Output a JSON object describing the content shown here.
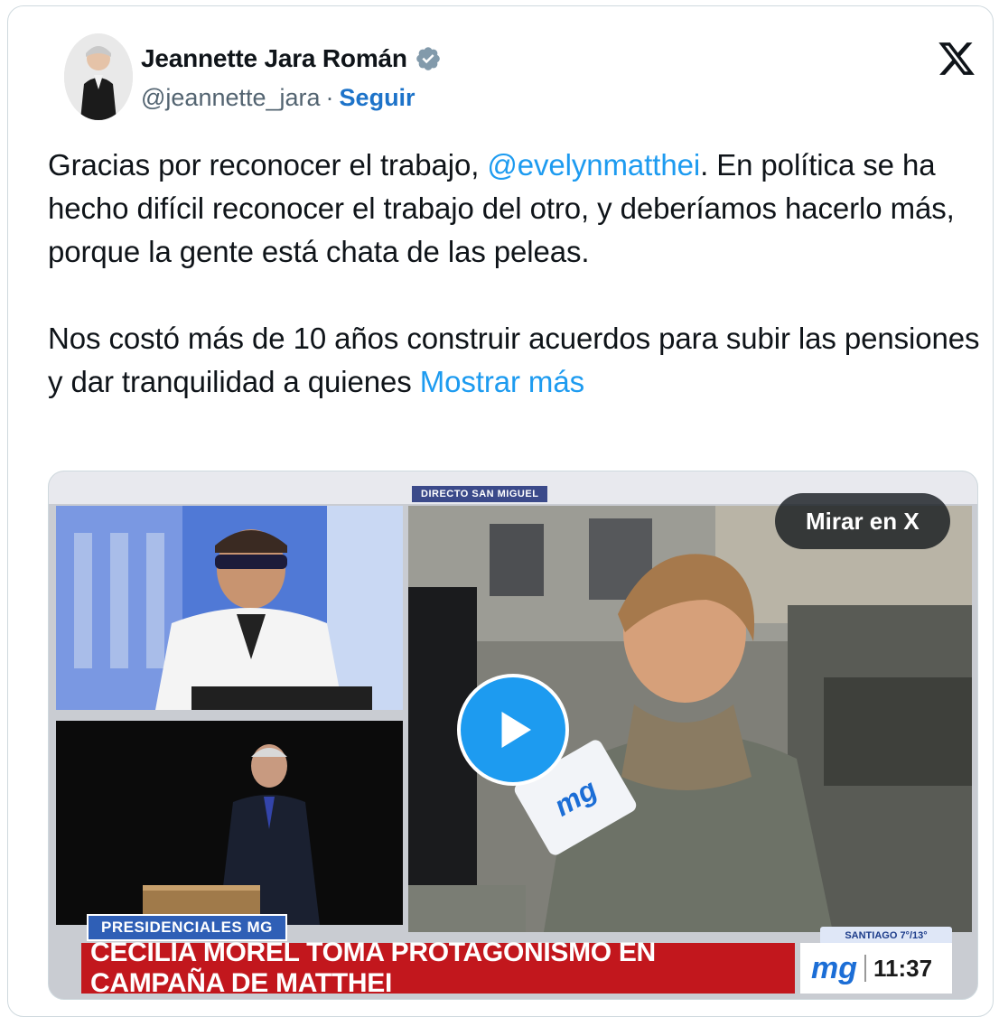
{
  "author": {
    "name": "Jeannette Jara Román",
    "handle": "@jeannette_jara",
    "separator": "·",
    "follow_label": "Seguir"
  },
  "tweet": {
    "p1_a": "Gracias por reconocer el trabajo, ",
    "mention": "@evelynmatthei",
    "p1_b": ". En política se ha hecho difícil reconocer el trabajo del otro, y deberíamos hacerlo más, porque la gente está chata de las peleas.",
    "p2": "Nos costó más de 10 años construir acuerdos para subir las pensiones y dar tranquilidad a quienes ",
    "show_more": "Mostrar más"
  },
  "media": {
    "watch_label": "Mirar en X",
    "direct_tag": "DIRECTO SAN MIGUEL",
    "section_tag": "PRESIDENCIALES MG",
    "headline": "CECILIA MOREL TOMA PROTAGONISMO EN CAMPAÑA DE MATTHEI",
    "brand_logo": "mg",
    "time": "11:37",
    "weather": "SANTIAGO 7°/13°",
    "mic_logo": "mg"
  },
  "colors": {
    "link": "#1d9bf0",
    "follow": "#1d73c9",
    "headline_bg": "#c2171d",
    "tag_bg": "#2f5fb6",
    "play": "#1d9bf0"
  }
}
